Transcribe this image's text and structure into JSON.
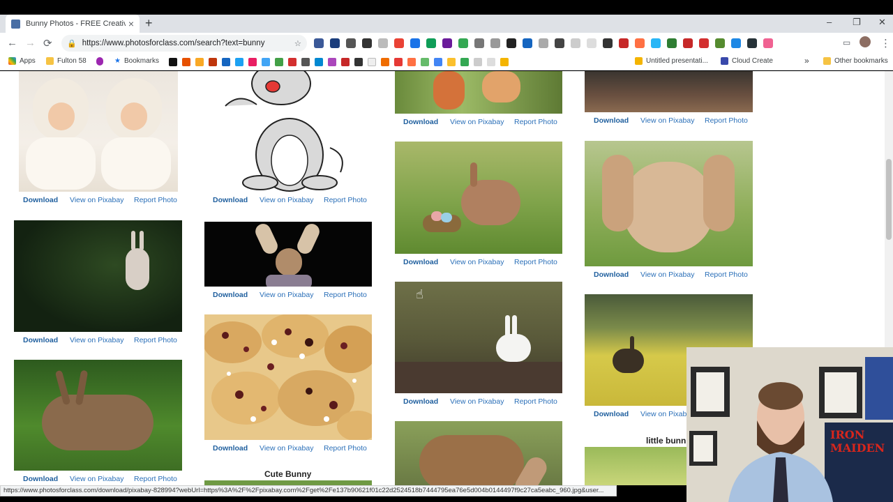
{
  "browser": {
    "tab_title": "Bunny Photos - FREE Creative Co",
    "new_tab": "+",
    "url": "https://www.photosforclass.com/search?text=bunny",
    "window_controls": [
      "–",
      "❐",
      "✕"
    ],
    "nav": {
      "back": "←",
      "forward": "→",
      "reload": "⟳"
    },
    "menu": "⋮"
  },
  "bookmarks": {
    "apps": "Apps",
    "fulton": "Fulton 58",
    "bookmarks": "Bookmarks",
    "untitled": "Untitled presentati...",
    "cloud": "Cloud Create",
    "more": "»",
    "other": "Other bookmarks"
  },
  "links": {
    "download": "Download",
    "view": "View on Pixabay",
    "report": "Report Photo"
  },
  "captions": {
    "cute_bunny": "Cute Bunny",
    "little_bunny": "little bunn"
  },
  "status_url": "https://www.photosforclass.com/download/pixabay-828994?webUrl=https%3A%2F%2Fpixabay.com%2Fget%2Fe137b90621f01c22d2524518b7444795ea76e5d004b0144497f9c27ca5eabc_960.jpg&user...",
  "webcam": {
    "poster_text": "IRON MAIDEN"
  },
  "colors": {
    "link": "#2a6fb8",
    "page_bg": "#ffffff",
    "chrome_bg": "#dee1e6"
  }
}
